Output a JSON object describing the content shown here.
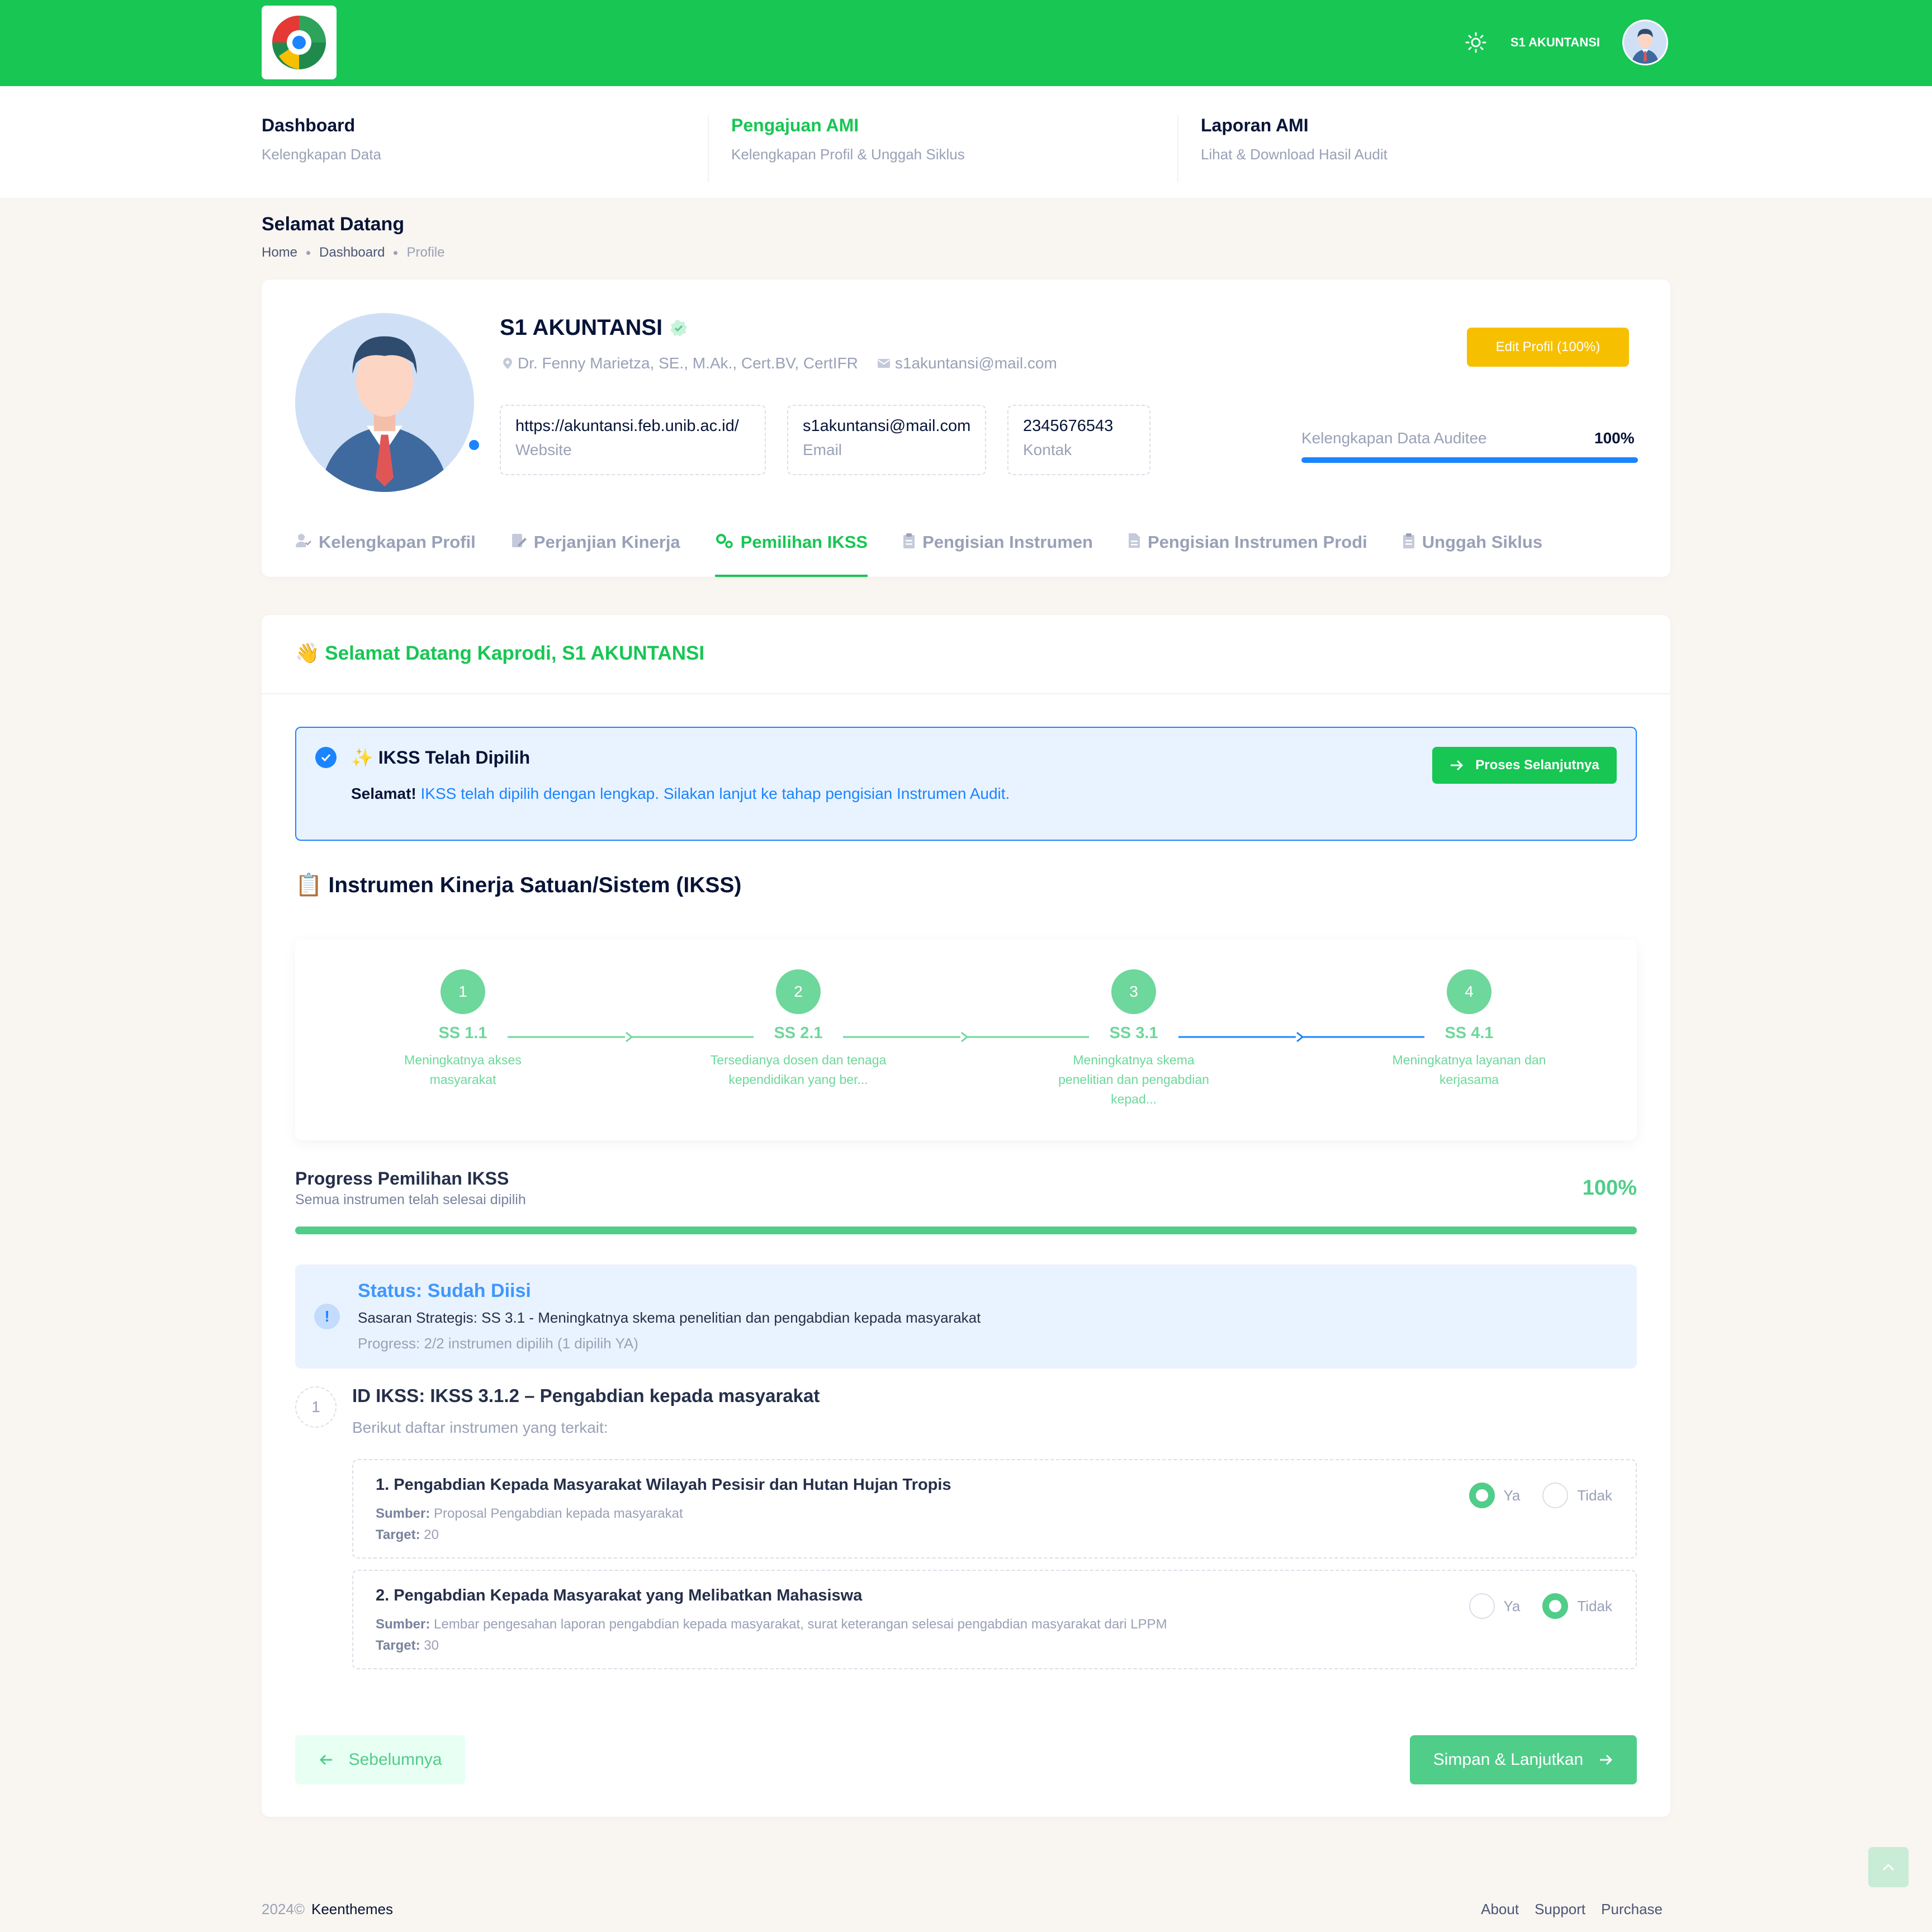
{
  "header": {
    "user_name": "S1 AKUNTANSI",
    "icons": [
      "logo",
      "sun-icon",
      "avatar"
    ]
  },
  "nav": [
    {
      "title": "Dashboard",
      "sub": "Kelengkapan Data",
      "active": false
    },
    {
      "title": "Pengajuan AMI",
      "sub": "Kelengkapan Profil & Unggah Siklus",
      "active": true
    },
    {
      "title": "Laporan AMI",
      "sub": "Lihat & Download Hasil Audit",
      "active": false
    }
  ],
  "page": {
    "title": "Selamat Datang",
    "breadcrumb": [
      "Home",
      "Dashboard",
      "Profile"
    ]
  },
  "profile": {
    "name": "S1 AKUNTANSI",
    "person": "Dr. Fenny Marietza, SE., M.Ak., Cert.BV, CertIFR",
    "email": "s1akuntansi@mail.com",
    "boxes": [
      {
        "value": "https://akuntansi.feb.unib.ac.id/",
        "label": "Website"
      },
      {
        "value": "s1akuntansi@mail.com",
        "label": "Email"
      },
      {
        "value": "2345676543",
        "label": "Kontak"
      }
    ],
    "edit_button": "Edit Profil (100%)",
    "completeness_label": "Kelengkapan Data Auditee",
    "completeness_value": "100%",
    "completeness_fraction": 1.0
  },
  "tabs": [
    {
      "label": "Kelengkapan Profil",
      "active": false
    },
    {
      "label": "Perjanjian Kinerja",
      "active": false
    },
    {
      "label": "Pemilihan IKSS",
      "active": true
    },
    {
      "label": "Pengisian Instrumen",
      "active": false
    },
    {
      "label": "Pengisian Instrumen Prodi",
      "active": false
    },
    {
      "label": "Unggah Siklus",
      "active": false
    }
  ],
  "main": {
    "welcome_prefix": "👋 Selamat Datang Kaprodi,",
    "welcome_name": "S1 AKUNTANSI",
    "alert": {
      "title": "✨ IKSS Telah Dipilih",
      "strong": "Selamat!",
      "text": "IKSS telah dipilih dengan lengkap. Silakan lanjut ke tahap pengisian Instrumen Audit.",
      "button": "Proses Selanjutnya"
    },
    "section_title": "📋 Instrumen Kinerja Satuan/Sistem (IKSS)",
    "steps": [
      {
        "num": "1",
        "code": "SS 1.1",
        "desc": "Meningkatnya akses masyarakat"
      },
      {
        "num": "2",
        "code": "SS 2.1",
        "desc": "Tersedianya dosen dan tenaga kependidikan yang ber..."
      },
      {
        "num": "3",
        "code": "SS 3.1",
        "desc": "Meningkatnya skema penelitian dan pengabdian kepad..."
      },
      {
        "num": "4",
        "code": "SS 4.1",
        "desc": "Meningkatnya layanan dan kerjasama"
      }
    ],
    "progress": {
      "title": "Progress Pemilihan IKSS",
      "sub": "Semua instrumen telah selesai dipilih",
      "pct": "100%",
      "fraction": 1.0
    },
    "status": {
      "title": "Status: Sudah Diisi",
      "ss": "Sasaran Strategis: SS 3.1 - Meningkatnya skema penelitian dan pengabdian kepada masyarakat",
      "progress": "Progress: 2/2 instrumen dipilih (1 dipilih YA)"
    },
    "ikss": {
      "index": "1",
      "id": "ID IKSS: IKSS 3.1.2 – Pengabdian kepada masyarakat",
      "sub": "Berikut daftar instrumen yang terkait:",
      "source_label": "Sumber:",
      "target_label": "Target:",
      "yes_label": "Ya",
      "no_label": "Tidak",
      "instruments": [
        {
          "title": "1. Pengabdian Kepada Masyarakat Wilayah Pesisir dan Hutan Hujan Tropis",
          "source": "Proposal Pengabdian kepada masyarakat",
          "target": "20",
          "selected": "Ya"
        },
        {
          "title": "2. Pengabdian Kepada Masyarakat yang Melibatkan Mahasiswa",
          "source": "Lembar pengesahan laporan pengabdian kepada masyarakat, surat keterangan selesai pengabdian masyarakat dari LPPM",
          "target": "30",
          "selected": "Tidak"
        }
      ]
    },
    "prev_button": "Sebelumnya",
    "next_button": "Simpan & Lanjutkan"
  },
  "footer": {
    "year": "2024©",
    "brand": "Keenthemes",
    "links": [
      "About",
      "Support",
      "Purchase"
    ]
  },
  "colors": {
    "primary_green": "#17c653",
    "soft_green": "#50cd89",
    "blue": "#1b84ff",
    "warning": "#f6c000"
  }
}
